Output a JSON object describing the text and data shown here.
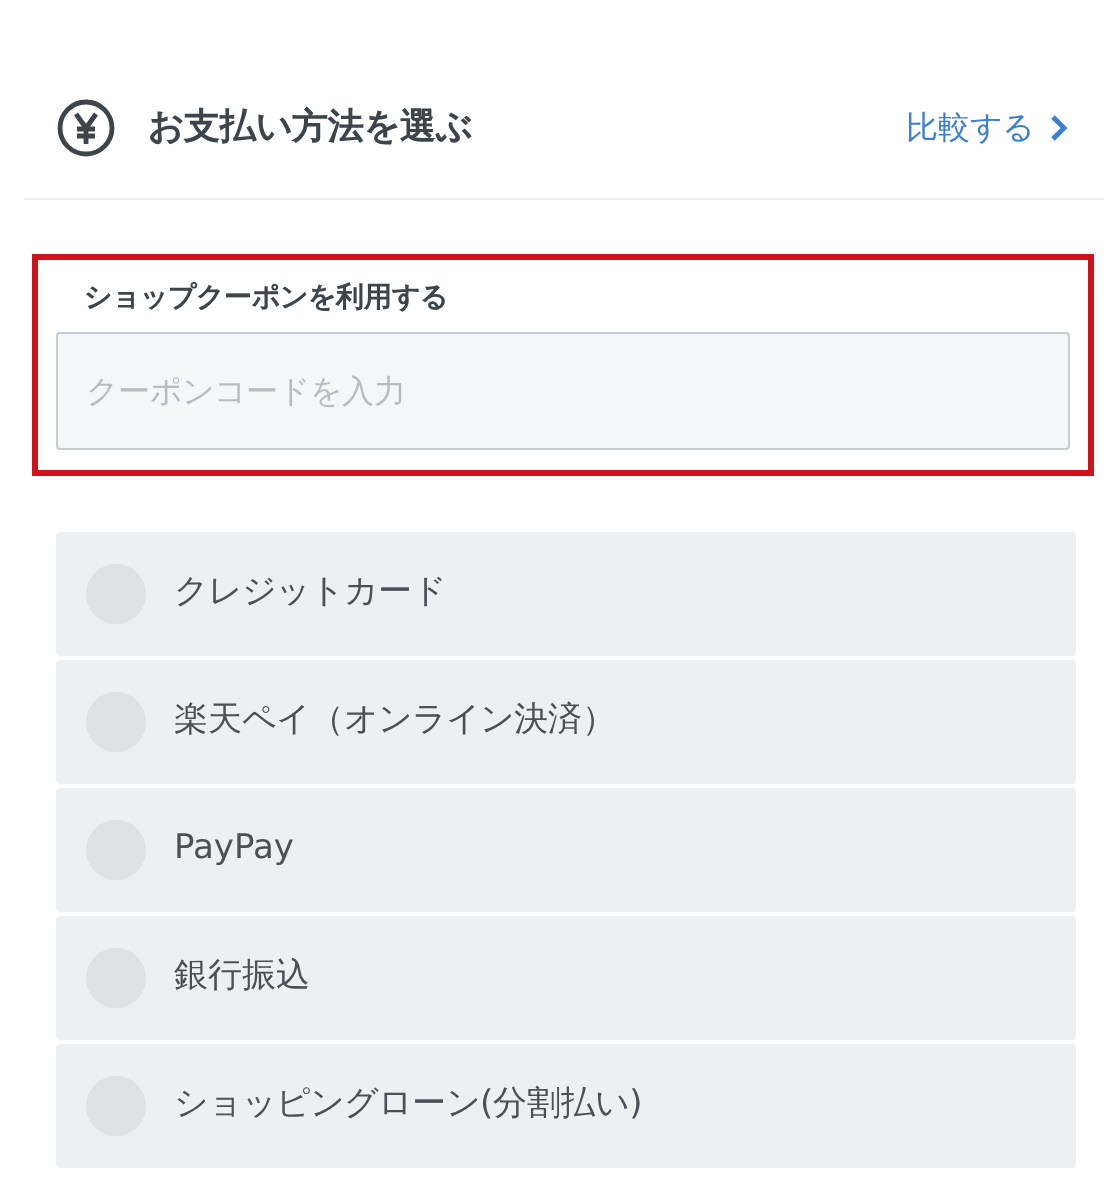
{
  "header": {
    "title": "お支払い方法を選ぶ",
    "compare_link": "比較する"
  },
  "coupon": {
    "label": "ショップクーポンを利用する",
    "placeholder": "クーポンコードを入力",
    "highlighted": true
  },
  "payment_methods": [
    {
      "label": "クレジットカード",
      "selected": false
    },
    {
      "label": "楽天ペイ（オンライン決済）",
      "selected": false
    },
    {
      "label": "PayPay",
      "selected": false
    },
    {
      "label": "銀行振込",
      "selected": false
    },
    {
      "label": "ショッピングローン(分割払い)",
      "selected": false
    }
  ]
}
